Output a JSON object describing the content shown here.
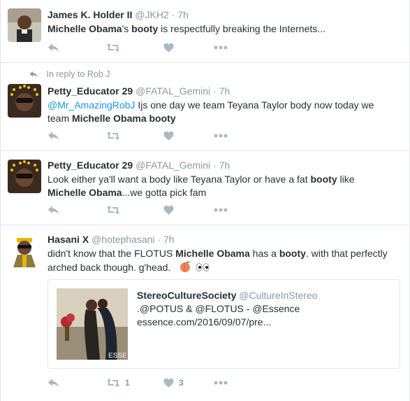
{
  "tweets": [
    {
      "fullname": "James K. Holder II",
      "handle": "@JKH2",
      "sep": "·",
      "time": "7h",
      "text": [
        "",
        "Michelle Obama",
        "'s ",
        "booty",
        " is respectfully breaking the Internets..."
      ]
    },
    {
      "context": "In reply to Rob J",
      "fullname": "Petty_Educator 29",
      "handle": "@FATAL_Gemini",
      "sep": "·",
      "time": "7h",
      "mention": "@Mr_AmazingRobJ",
      "text_line1": " Ijs one day we team Teyana Taylor body now today we",
      "text_line2_pre": "team ",
      "bold1": "Michelle Obama",
      "bold2": "booty"
    },
    {
      "fullname": "Petty_Educator 29",
      "handle": "@FATAL_Gemini",
      "sep": "·",
      "time": "7h",
      "line1_pre": "Look either ya'll want a body like Teyana Taylor or have a fat ",
      "line1_bold": "booty",
      "line1_post": " like",
      "line2_bold": "Michelle Obama",
      "line2_post": "...we gotta pick fam"
    },
    {
      "fullname": "Hasani X",
      "handle": "@hotephasani",
      "sep": "·",
      "time": "7h",
      "line1_pre": "didn't know that the FLOTUS ",
      "line1_bold1": "Michelle Obama",
      "line1_mid": " has a ",
      "line1_bold2": "booty",
      "line1_post": ". with that perfectly",
      "line2": "arched back though. g'head.",
      "emoji1": "peach-emoji",
      "emoji2": "eyes-emoji",
      "retweets": "1",
      "likes": "3",
      "card": {
        "name": "StereoCultureSociety",
        "handle": "@CultureInStereo",
        "text": ".@POTUS & @FLOTUS - @Essence",
        "link": "essence.com/2016/09/07/pre...",
        "img_watermark": "ESSE"
      }
    }
  ],
  "colors": {
    "link": "#1b95e0",
    "meta": "#8899a6",
    "icon": "#aab8c2",
    "border": "#e1e8ed"
  }
}
